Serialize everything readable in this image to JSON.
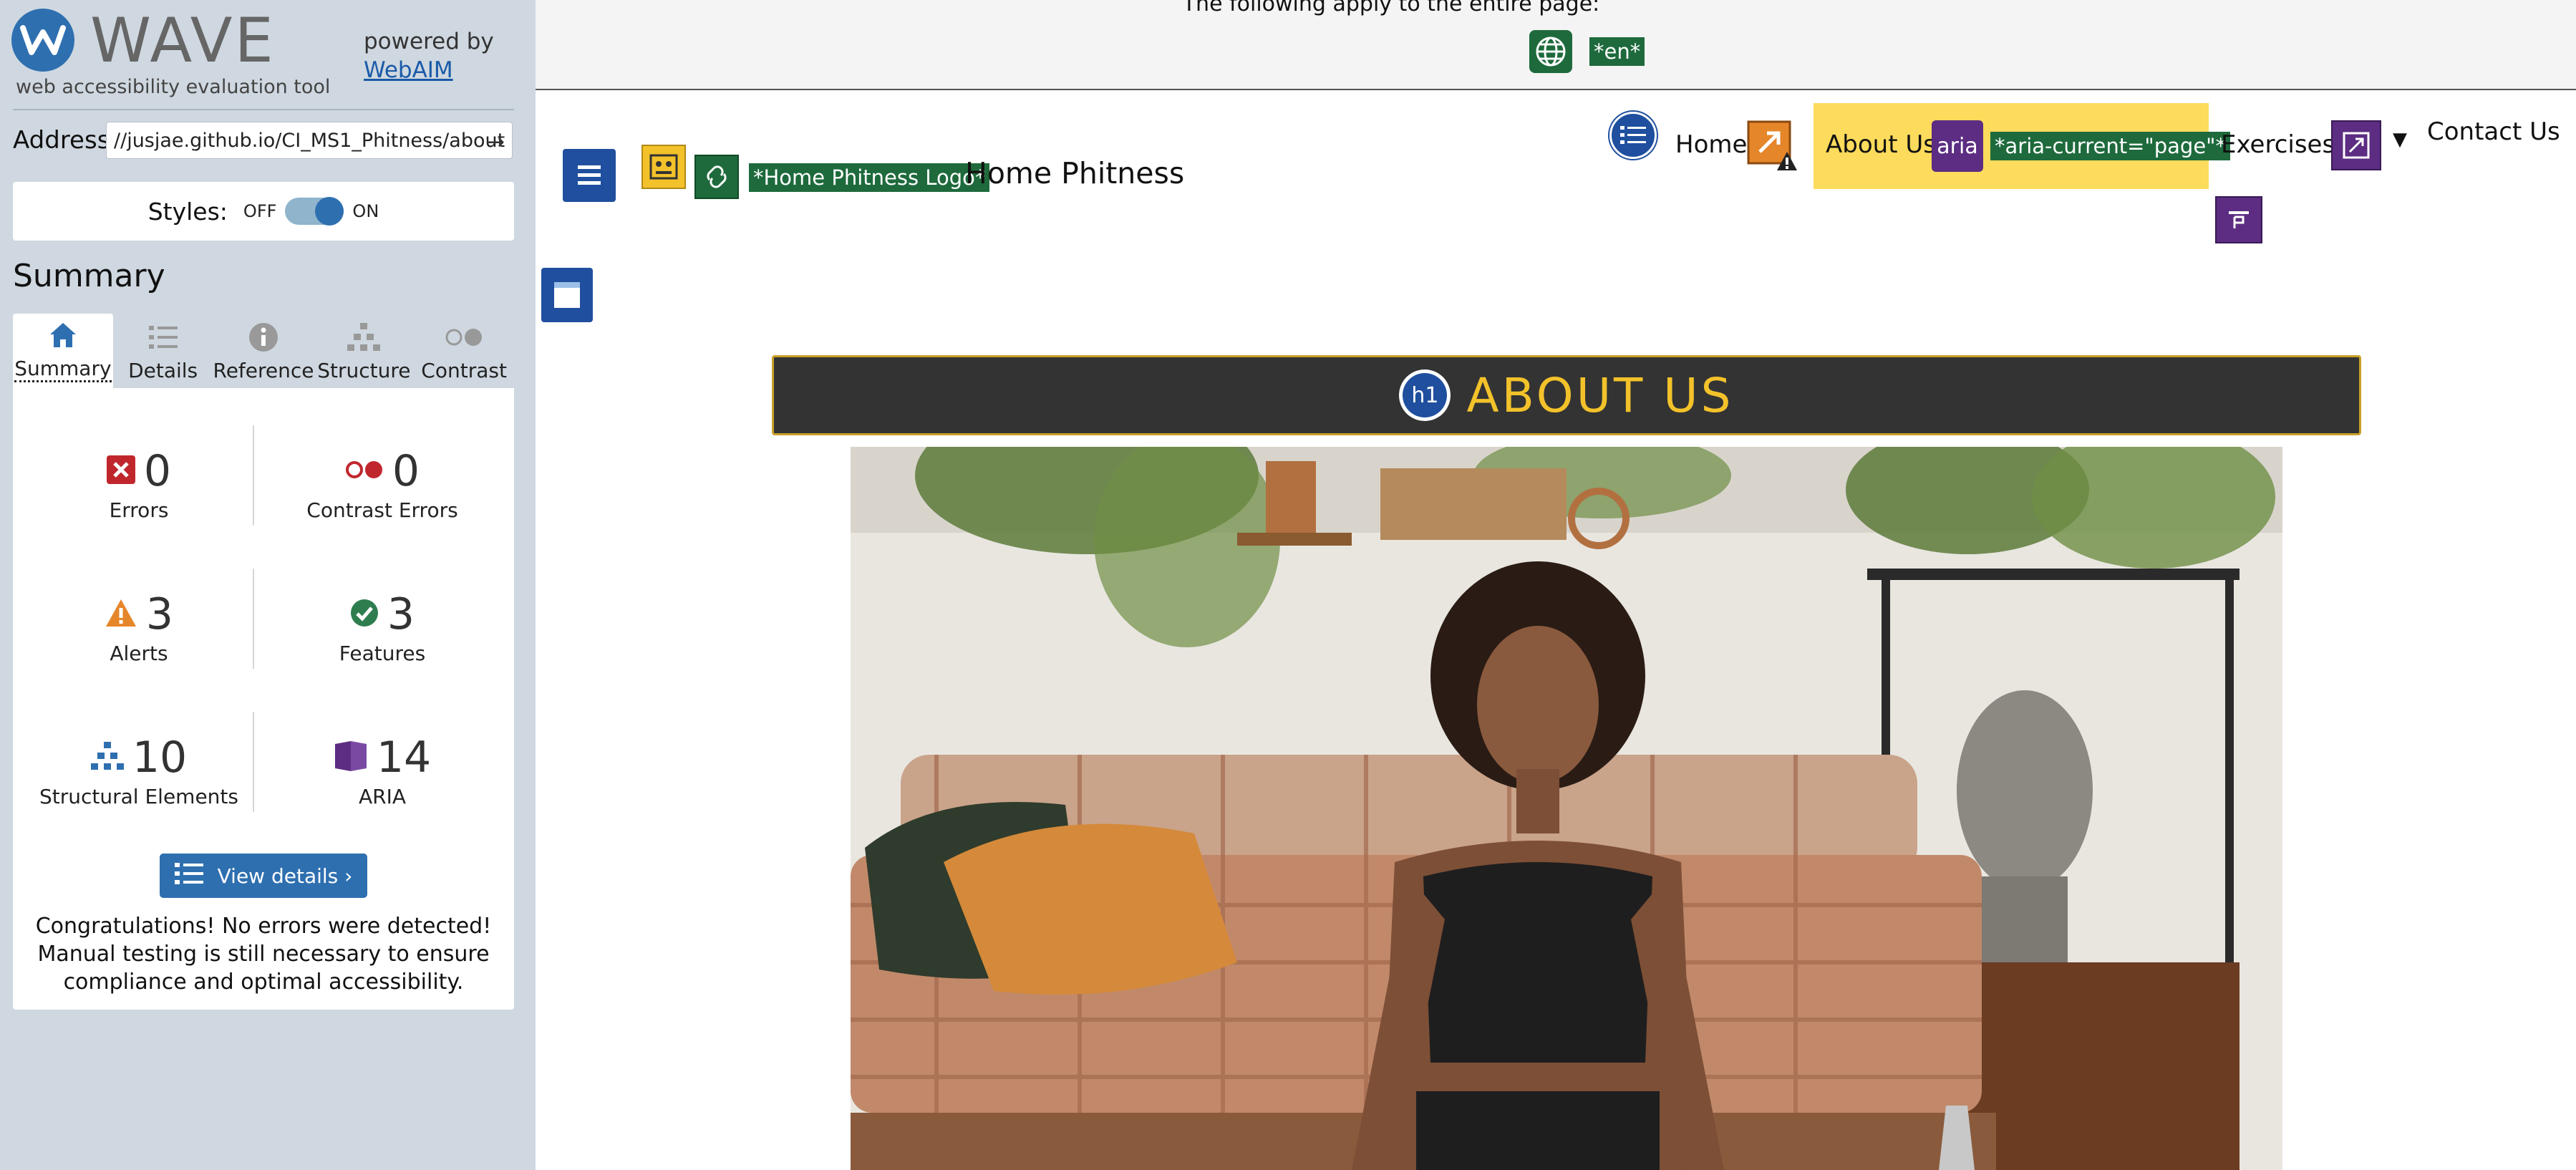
{
  "colors": {
    "wave_blue": "#2e6fb0",
    "sidebar_bg": "#cfd8e0",
    "error_red": "#c0272d",
    "alert_orange": "#e6862a",
    "feature_green": "#2e7d4f",
    "aria_purple": "#5c2d82",
    "about_highlight": "#fddb5c",
    "heading_gold": "#f3c22a"
  },
  "sidebar": {
    "brand": "WAVE",
    "tagline": "web accessibility evaluation tool",
    "powered_by": "powered by",
    "webaim_link": "WebAIM",
    "address_label": "Address:",
    "address_value": "//jusjae.github.io/CI_MS1_Phitness/about",
    "styles_label": "Styles:",
    "styles_off": "OFF",
    "styles_on": "ON",
    "styles_state": "on",
    "summary_heading": "Summary",
    "tabs": [
      {
        "label": "Summary",
        "icon": "home-icon",
        "active": true
      },
      {
        "label": "Details",
        "icon": "list-icon",
        "active": false
      },
      {
        "label": "Reference",
        "icon": "info-icon",
        "active": false
      },
      {
        "label": "Structure",
        "icon": "hierarchy-icon",
        "active": false
      },
      {
        "label": "Contrast",
        "icon": "contrast-icon",
        "active": false
      }
    ],
    "stats": {
      "errors": {
        "count": "0",
        "label": "Errors",
        "icon": "error-icon"
      },
      "contrast_errors": {
        "count": "0",
        "label": "Contrast Errors",
        "icon": "contrast-error-icon"
      },
      "alerts": {
        "count": "3",
        "label": "Alerts",
        "icon": "alert-icon"
      },
      "features": {
        "count": "3",
        "label": "Features",
        "icon": "feature-icon"
      },
      "structural": {
        "count": "10",
        "label": "Structural Elements",
        "icon": "structure-icon"
      },
      "aria": {
        "count": "14",
        "label": "ARIA",
        "icon": "aria-icon"
      }
    },
    "view_details": "View details ›",
    "congrats": "Congratulations! No errors were detected! Manual testing is still necessary to ensure compliance and optimal accessibility."
  },
  "preview": {
    "top_note": "The following apply to the entire page:",
    "lang_tag": "*en*",
    "logo_alt_tag": "*Home Phitness Logo*",
    "brand_name": "Home Phitness",
    "nav": {
      "home": "Home",
      "about": "About Us",
      "aria_label": "aria",
      "aria_current_tag": "*aria-current=\"page\"*",
      "exercises": "Exercises",
      "contact": "Contact Us"
    },
    "heading_badge": "h1",
    "heading": "ABOUT US"
  }
}
